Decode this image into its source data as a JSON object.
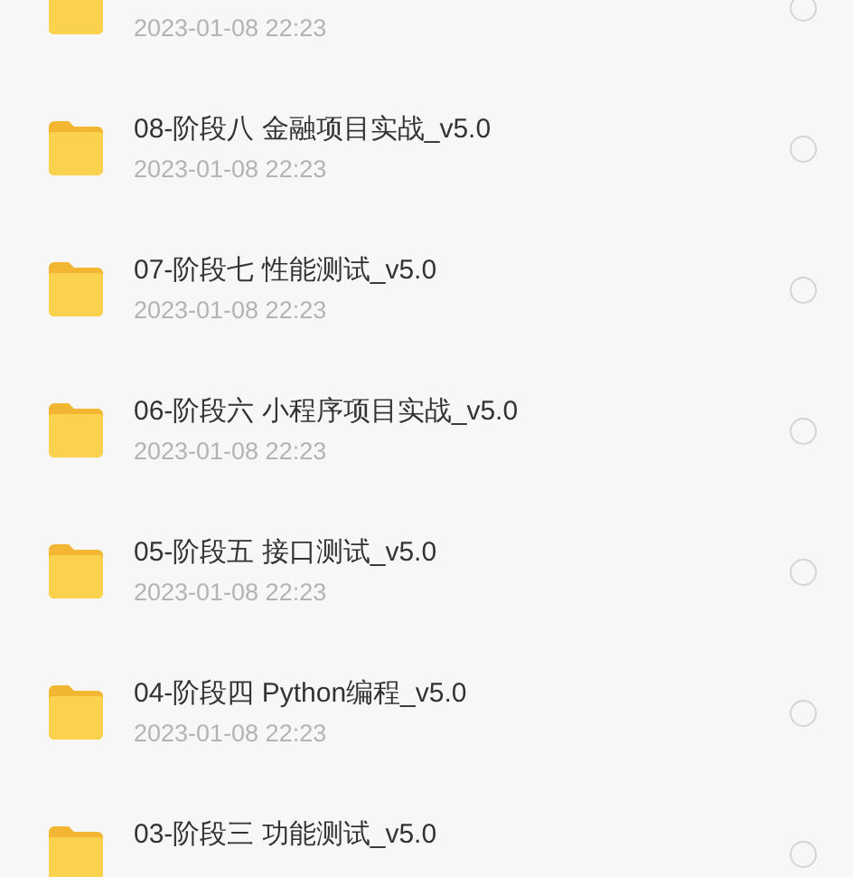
{
  "files": [
    {
      "date": "2023-01-08 22:23",
      "selected": false
    },
    {
      "name": "08-阶段八 金融项目实战_v5.0",
      "date": "2023-01-08 22:23",
      "selected": false
    },
    {
      "name": "07-阶段七 性能测试_v5.0",
      "date": "2023-01-08 22:23",
      "selected": false
    },
    {
      "name": "06-阶段六 小程序项目实战_v5.0",
      "date": "2023-01-08 22:23",
      "selected": false
    },
    {
      "name": "05-阶段五 接口测试_v5.0",
      "date": "2023-01-08 22:23",
      "selected": false
    },
    {
      "name": "04-阶段四 Python编程_v5.0",
      "date": "2023-01-08 22:23",
      "selected": false
    },
    {
      "name": "03-阶段三 功能测试_v5.0",
      "selected": false
    }
  ]
}
